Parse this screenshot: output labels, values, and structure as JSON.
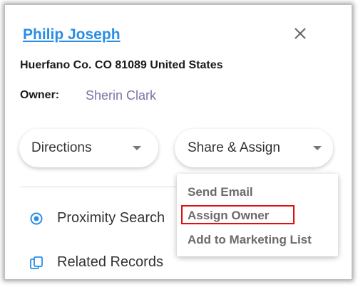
{
  "contact": {
    "name": "Philip Joseph",
    "address": "Huerfano Co. CO 81089 United States",
    "owner_label": "Owner:",
    "owner_name": "Sherin Clark"
  },
  "actions": {
    "directions_label": "Directions",
    "share_assign_label": "Share & Assign"
  },
  "dropdown": {
    "items": [
      "Send Email",
      "Assign Owner",
      "Add to Marketing List"
    ],
    "highlighted": "Assign Owner",
    "highlight_color": "#e01010"
  },
  "list": {
    "items": [
      {
        "label": "Proximity Search",
        "icon": "target-icon"
      },
      {
        "label": "Related Records",
        "icon": "records-icon"
      }
    ]
  },
  "colors": {
    "title": "#2a8ee6",
    "owner_name": "#8070a8",
    "accent_icon": "#2a8ee6"
  }
}
